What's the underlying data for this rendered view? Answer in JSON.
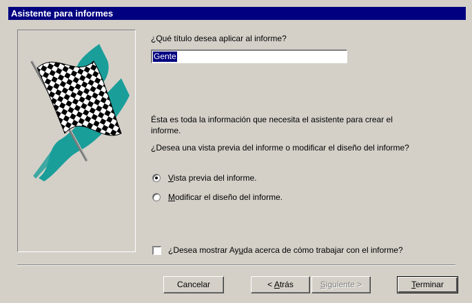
{
  "window": {
    "title": "Asistente para informes"
  },
  "art": {
    "icon": "checkered-flag-icon",
    "accent_color": "#1a9e9a"
  },
  "title_prompt": "¿Qué título desea aplicar al informe?",
  "title_input": {
    "value": "Gente"
  },
  "info_text_line1": "Ésta es toda la información que necesita el asistente para crear el",
  "info_text_line2": "informe.",
  "question": "¿Desea una vista previa del informe o modificar el diseño del informe?",
  "options": [
    {
      "label": "Vista previa del informe.",
      "selected": true
    },
    {
      "label": "Modificar el diseño del informe.",
      "selected": false
    }
  ],
  "help_checkbox": {
    "label": "¿Desea mostrar Ayuda acerca de cómo trabajar con el informe?",
    "checked": false
  },
  "buttons": {
    "cancel": "Cancelar",
    "back": "< Atrás",
    "next": "Siguiente >",
    "finish": "Terminar"
  }
}
